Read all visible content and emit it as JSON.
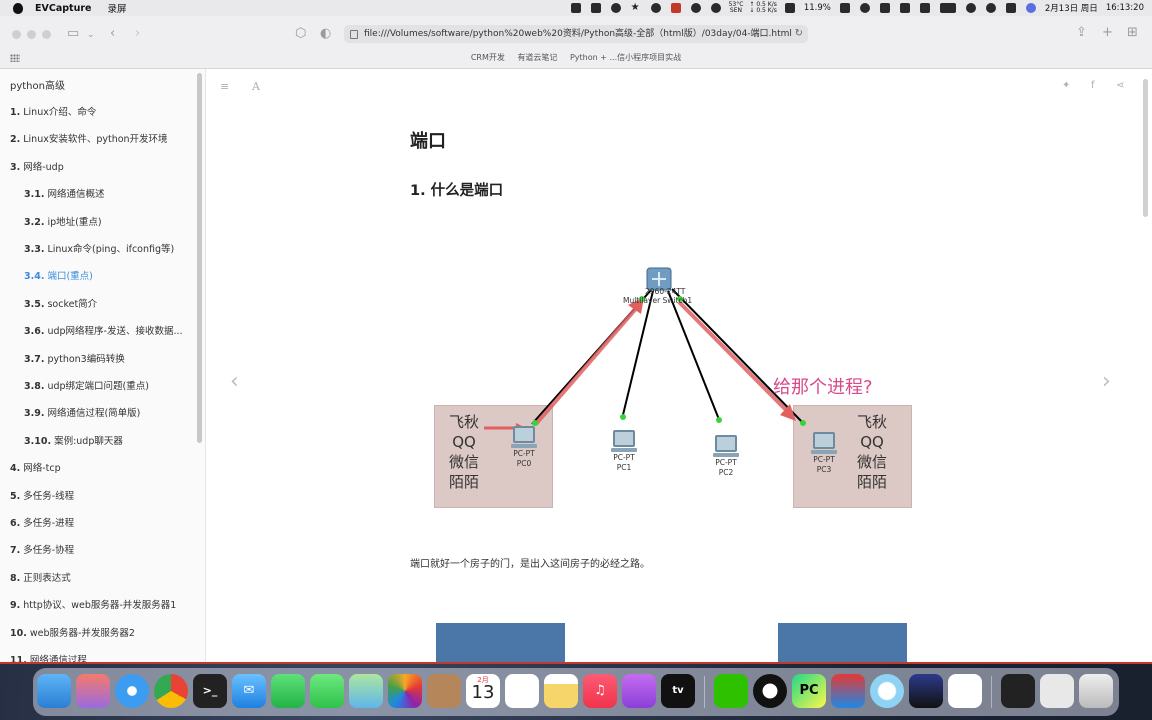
{
  "menubar": {
    "app_name": "EVCapture",
    "menu_item": "录屏",
    "cpu_temp": "53°C",
    "cpu_temp_sub": "SEN",
    "net_up": "↑ 0.5 K/s",
    "net_down": "↓ 0.5 K/s",
    "cpu_usage": "11.9%",
    "date": "2月13日 周日",
    "time": "16:13:20"
  },
  "browser": {
    "address": "file:///Volumes/software/python%20web%20资料/Python高级-全部（html版）/03day/04-端口.html",
    "bookmarks": [
      "CRM开发",
      "有道云笔记",
      "Python + ...信小程序项目实战"
    ]
  },
  "sidebar": {
    "title": "python高级",
    "items": [
      {
        "num": "1.",
        "label": "Linux介绍、命令"
      },
      {
        "num": "2.",
        "label": "Linux安装软件、python开发环境"
      },
      {
        "num": "3.",
        "label": "网络-udp"
      },
      {
        "num": "3.1.",
        "label": "网络通信概述"
      },
      {
        "num": "3.2.",
        "label": "ip地址(重点)"
      },
      {
        "num": "3.3.",
        "label": "Linux命令(ping、ifconfig等)"
      },
      {
        "num": "3.4.",
        "label": "端口(重点)"
      },
      {
        "num": "3.5.",
        "label": "socket简介"
      },
      {
        "num": "3.6.",
        "label": "udp网络程序-发送、接收数据..."
      },
      {
        "num": "3.7.",
        "label": "python3编码转换"
      },
      {
        "num": "3.8.",
        "label": "udp绑定端口问题(重点)"
      },
      {
        "num": "3.9.",
        "label": "网络通信过程(简单版)"
      },
      {
        "num": "3.10.",
        "label": "案例:udp聊天器"
      },
      {
        "num": "4.",
        "label": "网络-tcp"
      },
      {
        "num": "5.",
        "label": "多任务-线程"
      },
      {
        "num": "6.",
        "label": "多任务-进程"
      },
      {
        "num": "7.",
        "label": "多任务-协程"
      },
      {
        "num": "8.",
        "label": "正则表达式"
      },
      {
        "num": "9.",
        "label": "http协议、web服务器-并发服务器1"
      },
      {
        "num": "10.",
        "label": "web服务器-并发服务器2"
      },
      {
        "num": "11.",
        "label": "网络通信过程"
      }
    ]
  },
  "content": {
    "page_title": "端口",
    "section_title": "1. 什么是端口",
    "paragraph": "端口就好一个房子的门，是出入这间房子的必经之路。",
    "diagram": {
      "switch_label_1": "2960-24TT",
      "switch_label_2": "Multilayer Switch1",
      "left_box_lines": [
        "飞秋",
        "QQ",
        "微信",
        "陌陌"
      ],
      "right_box_lines": [
        "飞秋",
        "QQ",
        "微信",
        "陌陌"
      ],
      "question": "给那个进程?",
      "pcs": [
        {
          "type": "PC-PT",
          "name": "PC0"
        },
        {
          "type": "PC-PT",
          "name": "PC1"
        },
        {
          "type": "PC-PT",
          "name": "PC2"
        },
        {
          "type": "PC-PT",
          "name": "PC3"
        }
      ],
      "highlight_color": "#e06060",
      "question_color": "#d84a8c"
    }
  },
  "dock": {
    "calendar_month": "2月",
    "calendar_day": "13",
    "pycharm_label": "PC"
  }
}
